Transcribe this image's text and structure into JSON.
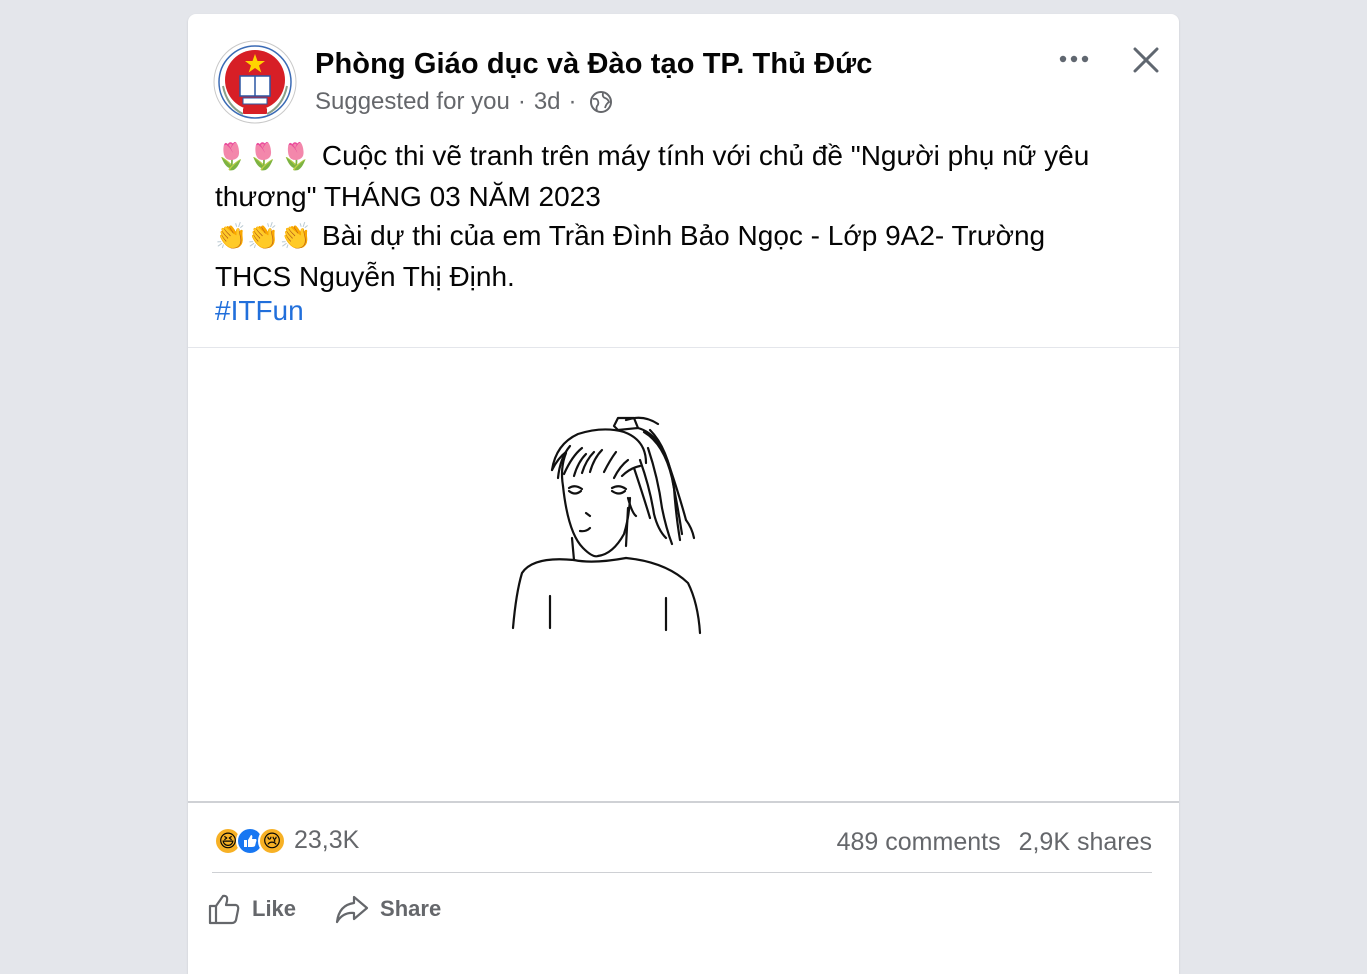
{
  "post": {
    "page_name": "Phòng Giáo dục và Đào tạo TP. Thủ Đức",
    "suggested": "Suggested for you",
    "separator": "·",
    "time": "3d",
    "audience_icon": "globe-icon",
    "more_icon": "more-options-icon",
    "close_icon": "close-icon",
    "text": {
      "line1_emoji": "🌷🌷🌷",
      "line1": "Cuộc thi vẽ tranh trên máy tính với chủ đề \"Người phụ nữ yêu",
      "line2": "thương\" THÁNG 03 NĂM 2023",
      "line3_emoji": "👏👏👏",
      "line3": "Bài dự thi của em Trần Đình Bảo Ngọc - Lớp 9A2- Trường",
      "line4": "THCS Nguyễn Thị Định.",
      "hashtag": "#ITFun"
    },
    "media_subject": "line drawing of a girl with a ponytail"
  },
  "stats": {
    "reaction_icons": [
      "haha",
      "like",
      "sad"
    ],
    "reaction_emoji": {
      "haha": "😆",
      "like": "👍",
      "sad": "😢"
    },
    "reaction_count": "23,3K",
    "comments": "489 comments",
    "shares": "2,9K shares"
  },
  "actions": {
    "like_label": "Like",
    "share_label": "Share"
  },
  "colors": {
    "background": "#e4e6eb",
    "secondary_text": "#65676b",
    "link": "#216fdb",
    "like_blue": "#1877f2"
  }
}
